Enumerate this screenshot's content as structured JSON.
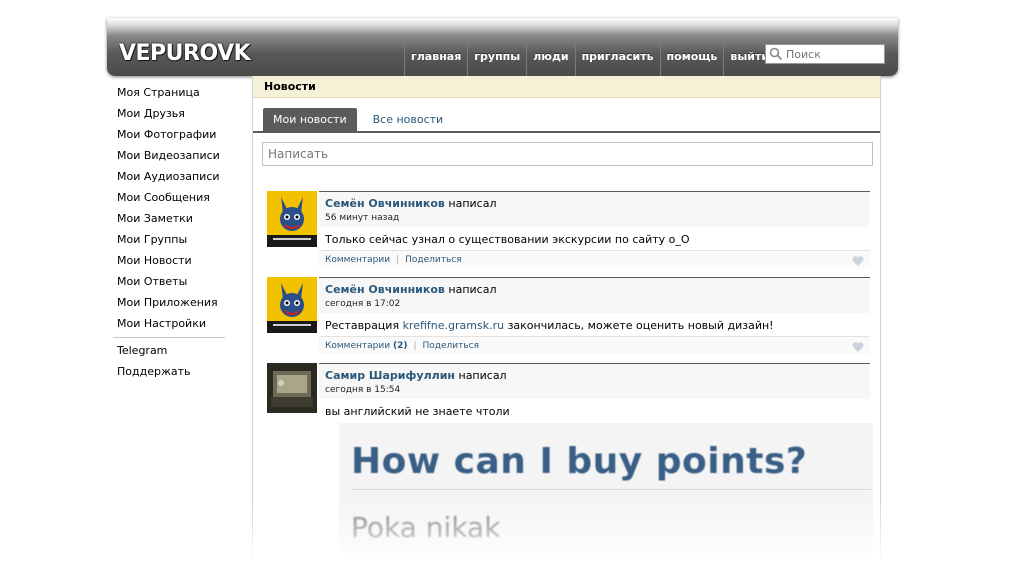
{
  "header": {
    "logo_text": "VEPUROVK",
    "nav": [
      "главная",
      "группы",
      "люди",
      "пригласить",
      "помощь",
      "выйти"
    ],
    "search_placeholder": "Поиск"
  },
  "sidebar": {
    "items": [
      "Моя Страница",
      "Мои Друзья",
      "Мои Фотографии",
      "Мои Видеозаписи",
      "Мои Аудиозаписи",
      "Мои Сообщения",
      "Мои Заметки",
      "Мои Группы",
      "Мои Новости",
      "Мои Ответы",
      "Мои Приложения",
      "Мои Настройки"
    ],
    "extra": [
      "Telegram",
      "Поддержать"
    ]
  },
  "main": {
    "title": "Новости",
    "tabs": [
      "Мои новости",
      "Все новости"
    ],
    "write_placeholder": "Написать"
  },
  "posts": [
    {
      "author": "Семён Овчинников",
      "verb": "написал",
      "time": "56 минут назад",
      "text": "Только сейчас узнал о существовании экскурсии по сайту о_О",
      "comments_label": "Комментарии",
      "share_label": "Поделиться"
    },
    {
      "author": "Семён Овчинников",
      "verb": "написал",
      "time": "сегодня в 17:02",
      "text_before": "Реставрация ",
      "text_link": "krefifne.gramsk.ru",
      "text_after": " закончилась, можете оценить новый дизайн!",
      "comments_label": "Комментарии",
      "comments_count": "(2)",
      "share_label": "Поделиться"
    },
    {
      "author": "Самир Шарифуллин",
      "verb": "написал",
      "time": "сегодня в 15:54",
      "text": "вы английский не знаете чтоли",
      "image_title": "How can I buy points?",
      "image_sub": "Poka nikak"
    }
  ],
  "colors": {
    "accent": "#2b587a",
    "header_dark": "#4a4a4a",
    "title_bar": "#f5f1d7"
  }
}
